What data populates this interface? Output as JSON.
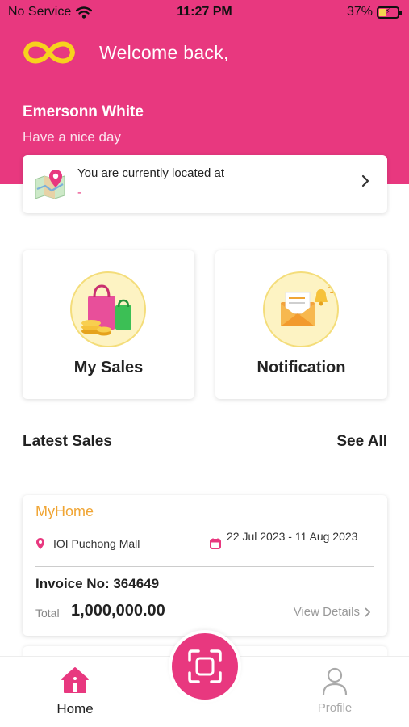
{
  "status_bar": {
    "carrier": "No Service",
    "time": "11:27 PM",
    "battery_percent": "37%",
    "battery_level": 0.37,
    "icons": [
      "wifi-icon",
      "battery-charging-icon"
    ]
  },
  "header": {
    "logo_icon": "infinity-logo",
    "welcome_text": "Welcome back,",
    "user_name": "Emersonn White",
    "greeting": "Have a nice day",
    "background_color": "#e8387f",
    "logo_color": "#f7d21d"
  },
  "location": {
    "title": "You are currently located at",
    "value": "-",
    "icon": "map-pin-icon"
  },
  "tiles": [
    {
      "label": "My Sales",
      "icon": "shopping-bags-coins-icon"
    },
    {
      "label": "Notification",
      "icon": "envelope-bell-icon"
    }
  ],
  "latest_sales": {
    "title": "Latest Sales",
    "see_all_label": "See All",
    "items": [
      {
        "shop": "MyHome",
        "location": "IOI Puchong Mall",
        "date_range": "22 Jul 2023 - 11 Aug 2023",
        "invoice": "Invoice No: 364649",
        "total_label": "Total",
        "total": "1,000,000.00",
        "view_details_label": "View Details"
      }
    ]
  },
  "bottom_nav": {
    "home_label": "Home",
    "profile_label": "Profile",
    "scan_icon": "scan-frame-icon",
    "accent_color": "#e8387f"
  }
}
